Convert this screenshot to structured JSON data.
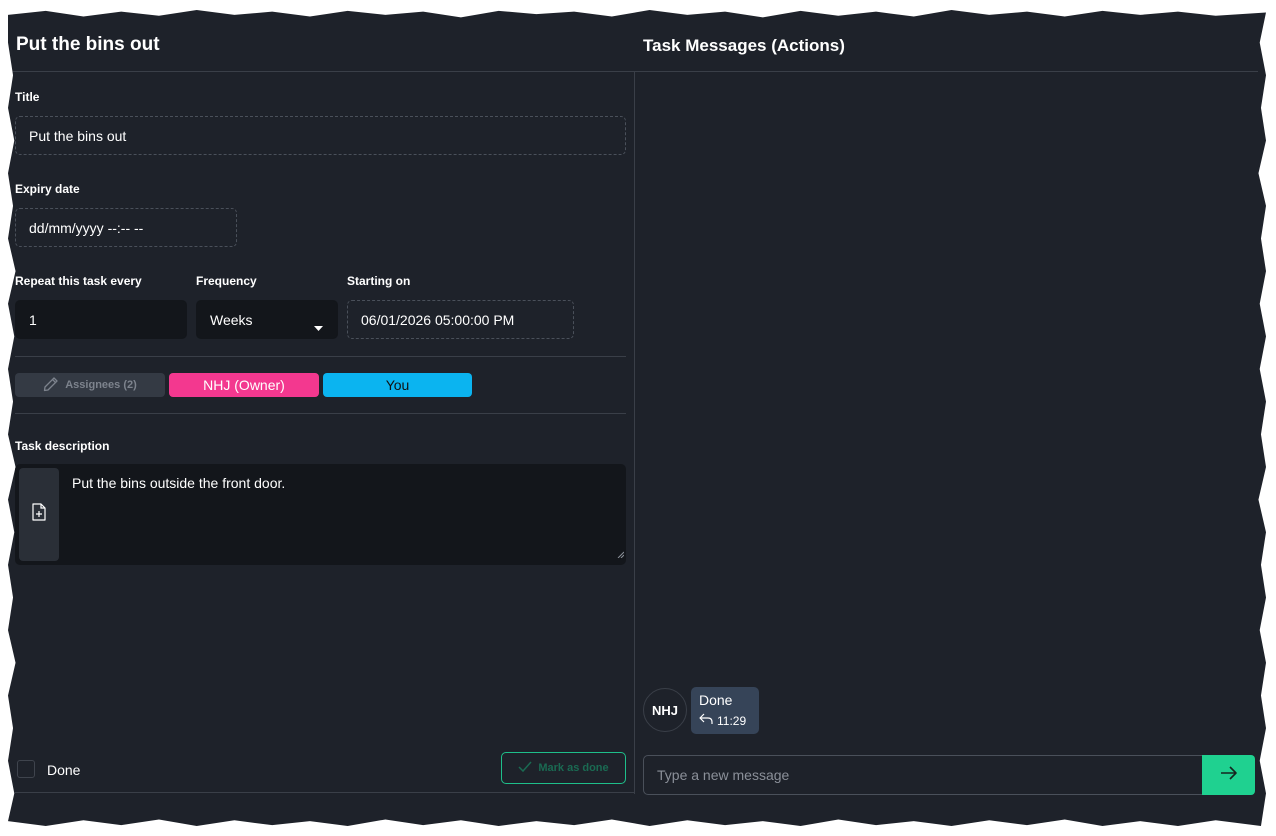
{
  "task": {
    "heading": "Put the bins out",
    "title_label": "Title",
    "title_value": "Put the bins out",
    "expiry_label": "Expiry date",
    "expiry_placeholder": "dd/mm/yyyy --:-- --",
    "repeat_label": "Repeat this task every",
    "repeat_value": "1",
    "frequency_label": "Frequency",
    "frequency_value": "Weeks",
    "starting_label": "Starting on",
    "starting_value": "06/01/2026 05:00:00 PM",
    "assignees_label": "Assignees (2)",
    "chips": [
      "NHJ (Owner)",
      "You"
    ],
    "description_label": "Task description",
    "description_value": "Put the bins outside the front door.",
    "done_label": "Done",
    "mark_done_label": "Mark as done"
  },
  "messages": {
    "heading": "Task Messages (Actions)",
    "items": [
      {
        "avatar": "NHJ",
        "text": "Done",
        "time": "11:29"
      }
    ],
    "input_placeholder": "Type a new message"
  },
  "colors": {
    "background": "#1e222a",
    "owner_chip": "#f3388f",
    "you_chip": "#0bb4f0",
    "send_button": "#1fd190",
    "mark_done_border": "#1ebf8a",
    "bubble": "#364458"
  },
  "icons": {
    "assignees": "pencil-icon",
    "description": "file-plus-icon",
    "frequency": "caret-down-icon",
    "mark_done": "checkmark-icon",
    "reply": "reply-icon",
    "send": "arrow-right-icon"
  }
}
